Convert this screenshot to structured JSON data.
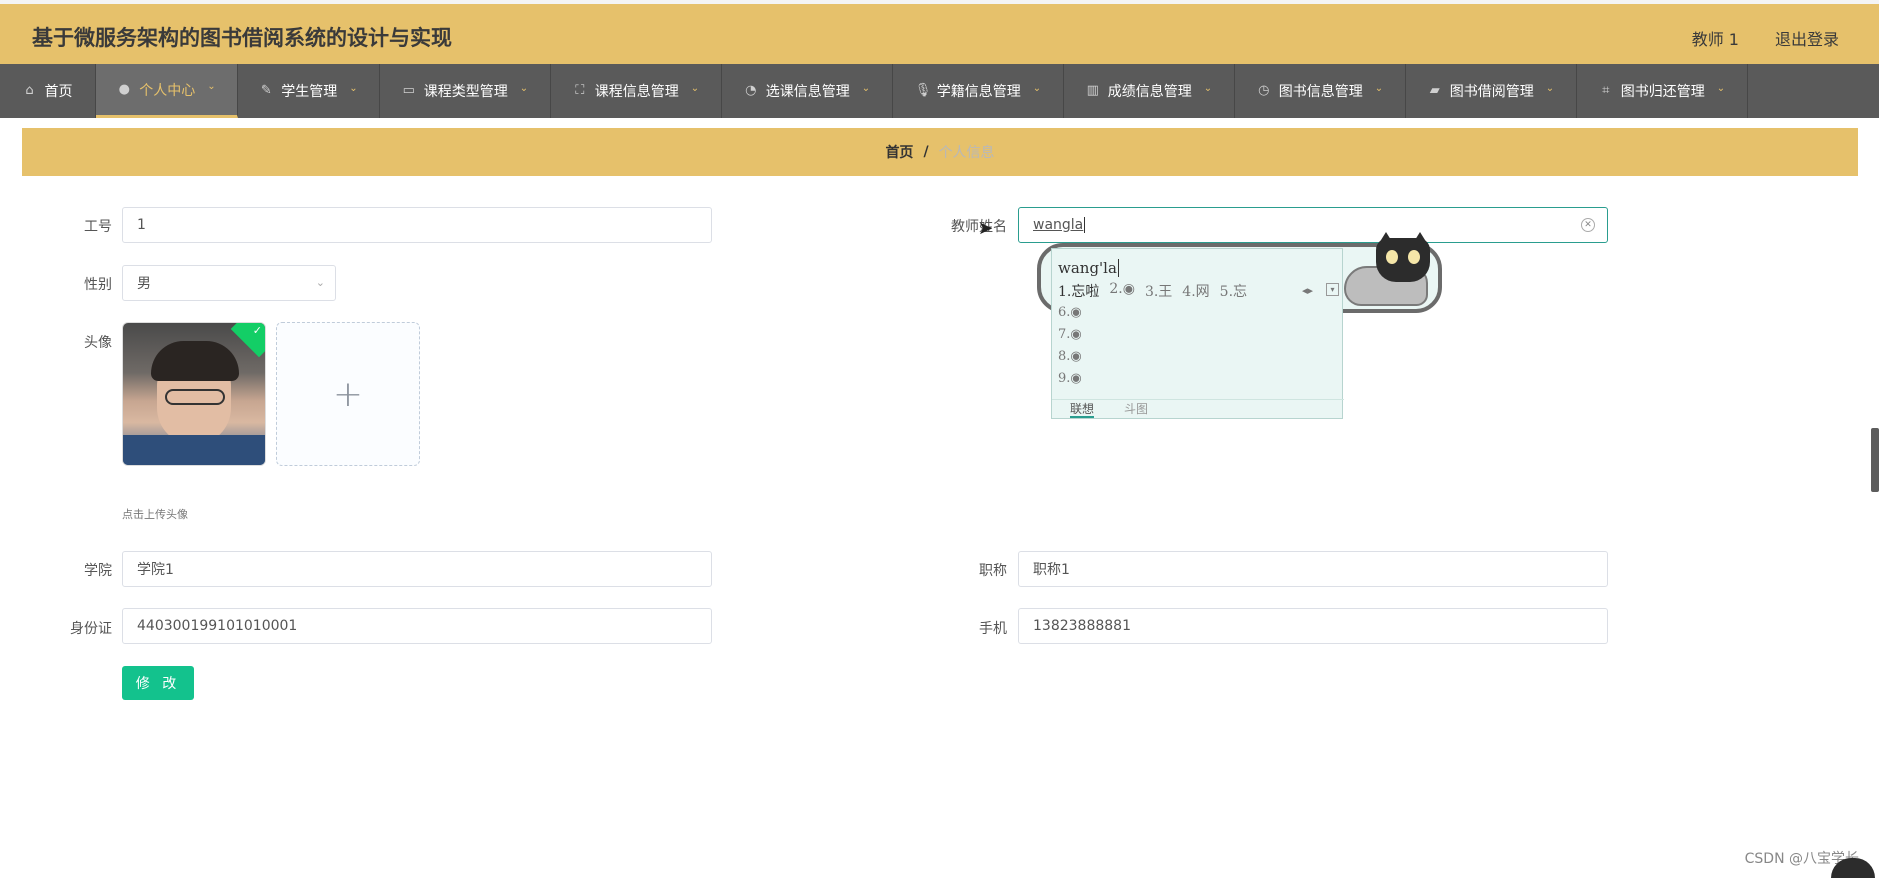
{
  "header": {
    "title": "基于微服务架构的图书借阅系统的设计与实现",
    "user": "教师 1",
    "logout": "退出登录"
  },
  "nav": [
    {
      "label": "首页",
      "icon": "home-icon",
      "has_menu": false,
      "active": false
    },
    {
      "label": "个人中心",
      "icon": "user-icon",
      "has_menu": true,
      "active": true
    },
    {
      "label": "学生管理",
      "icon": "student-icon",
      "has_menu": true,
      "active": false
    },
    {
      "label": "课程类型管理",
      "icon": "card-icon",
      "has_menu": true,
      "active": false
    },
    {
      "label": "课程信息管理",
      "icon": "fullscreen-icon",
      "has_menu": true,
      "active": false
    },
    {
      "label": "选课信息管理",
      "icon": "compass-icon",
      "has_menu": true,
      "active": false
    },
    {
      "label": "学籍信息管理",
      "icon": "mic-icon",
      "has_menu": true,
      "active": false
    },
    {
      "label": "成绩信息管理",
      "icon": "chart-icon",
      "has_menu": true,
      "active": false
    },
    {
      "label": "图书信息管理",
      "icon": "clock-icon",
      "has_menu": true,
      "active": false
    },
    {
      "label": "图书借阅管理",
      "icon": "ticket-icon",
      "has_menu": true,
      "active": false
    },
    {
      "label": "图书归还管理",
      "icon": "crop-icon",
      "has_menu": true,
      "active": false
    }
  ],
  "breadcrumb": {
    "home": "首页",
    "sep": "/",
    "current": "个人信息"
  },
  "form": {
    "job_no_label": "工号",
    "job_no_value": "1",
    "name_label": "教师姓名",
    "name_value": "wangla",
    "gender_label": "性别",
    "gender_value": "男",
    "avatar_label": "头像",
    "avatar_hint": "点击上传头像",
    "upload_plus": "+",
    "college_label": "学院",
    "college_value": "学院1",
    "title_label": "职称",
    "title_value": "职称1",
    "id_label": "身份证",
    "id_value": "440300199101010001",
    "phone_label": "手机",
    "phone_value": "13823888881",
    "submit": "修 改"
  },
  "ime": {
    "pinyin": "wang'la",
    "cands": [
      "1.忘啦",
      "2.",
      "3.王",
      "4.网",
      "5.忘"
    ],
    "rows": [
      "6.",
      "7.",
      "8.",
      "9."
    ],
    "tab_1": "联想",
    "tab_2": "斗图"
  },
  "watermark": "CSDN @八宝学长",
  "colors": {
    "header_bg": "#e6c16b",
    "nav_bg": "#5a5a5a",
    "button": "#13c28d"
  }
}
